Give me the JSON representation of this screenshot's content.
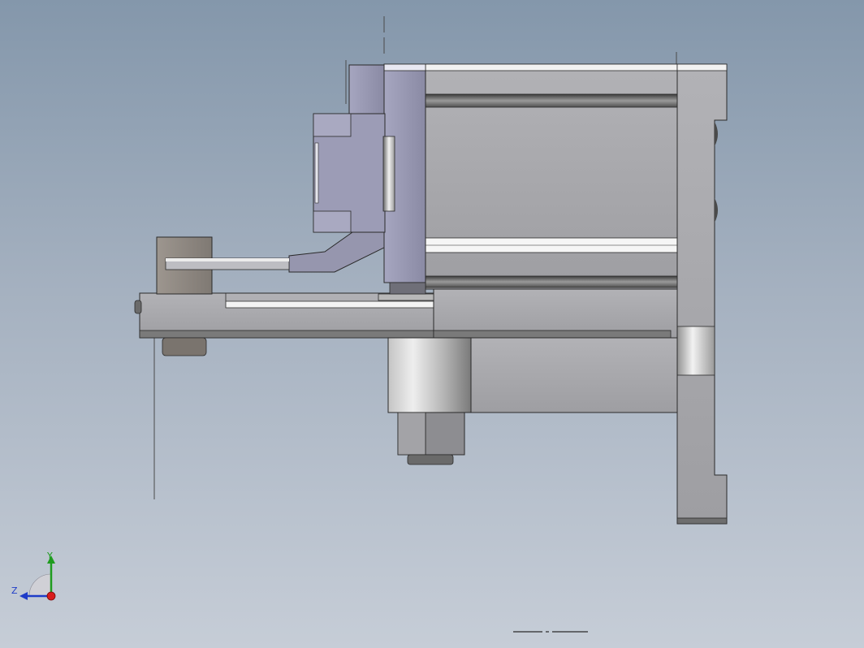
{
  "viewport": {
    "background_top": "#8497ab",
    "background_bottom": "#c6cdd7"
  },
  "triad": {
    "y_label": "Y",
    "z_label": "Z",
    "y_color": "#1f9c1f",
    "z_color": "#1f3cc8",
    "x_color": "#d81c1c"
  },
  "scale_bar": {
    "icon": "scale-bar-icon"
  },
  "colors": {
    "part_gray": "#a8a8ac",
    "part_dark_gray": "#8e8e92",
    "lavender_part": "#9a9ab2",
    "tan_part": "#8f8983",
    "edge": "#2a2a2a",
    "highlight": "#f4f4f4"
  }
}
